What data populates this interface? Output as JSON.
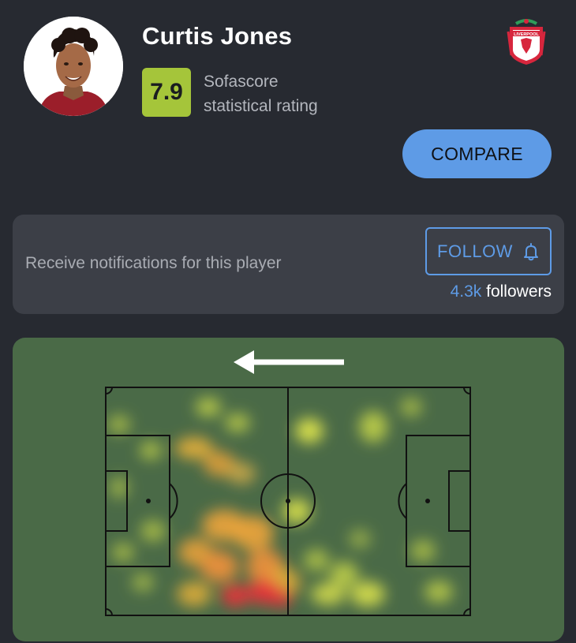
{
  "player": {
    "name": "Curtis Jones",
    "rating": "7.9",
    "rating_caption_line1": "Sofascore",
    "rating_caption_line2": "statistical rating"
  },
  "club": {
    "name": "Liverpool",
    "logo_icon": "liverpool-crest-icon",
    "logo_text": "LIVERPOOL"
  },
  "actions": {
    "compare_label": "COMPARE"
  },
  "follow": {
    "prompt": "Receive notifications for this player",
    "button_label": "FOLLOW",
    "button_icon": "bell-icon",
    "followers_count": "4.3k",
    "followers_label": "followers"
  },
  "heatmap": {
    "direction_icon": "arrow-left-icon",
    "colors": {
      "pitch": "#4a6a47",
      "low": "#d6e34a",
      "mid": "#f0a53a",
      "high": "#e8313a"
    }
  },
  "colors": {
    "background": "#272a31",
    "accent": "#5e9be6",
    "rating": "#a5c53a",
    "card": "#3c3f47"
  }
}
